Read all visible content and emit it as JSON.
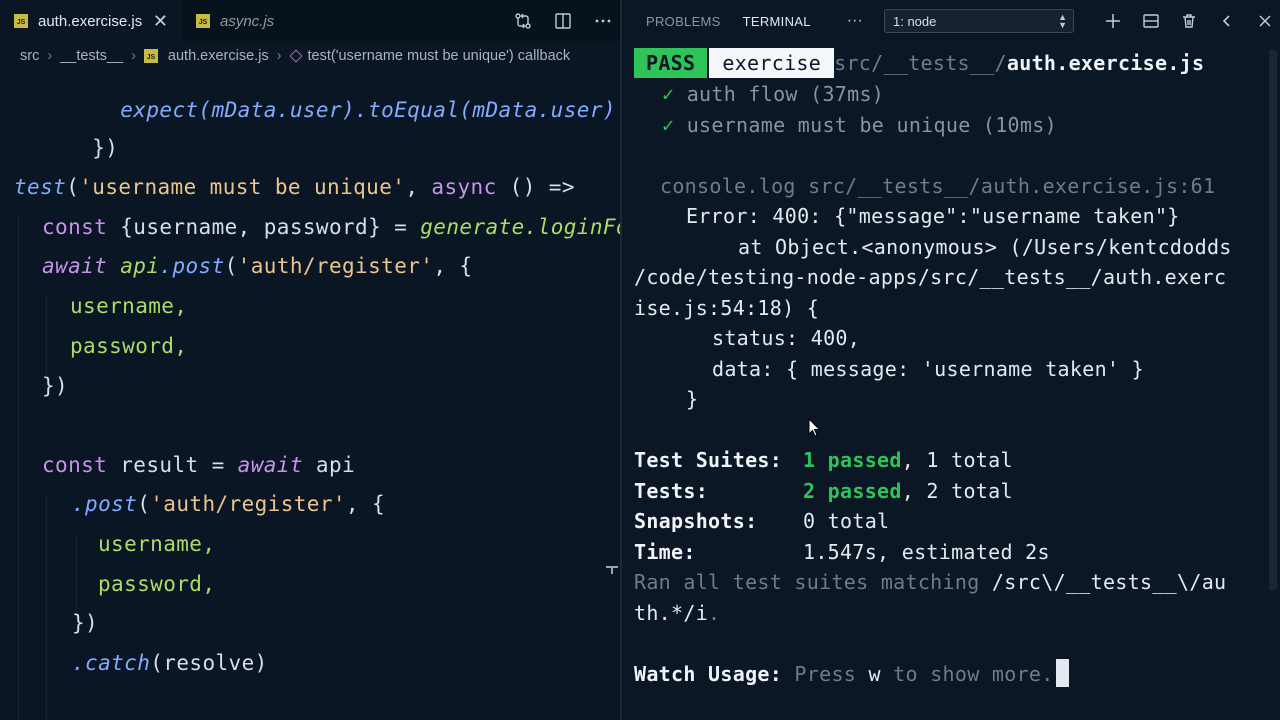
{
  "editor": {
    "tabs": [
      {
        "label": "auth.exercise.js",
        "active": true,
        "icon": "js-file-icon"
      },
      {
        "label": "async.js",
        "active": false,
        "icon": "js-file-icon"
      }
    ],
    "js_badge": "JS",
    "breadcrumb": {
      "parts": [
        "src",
        "__tests__",
        "auth.exercise.js"
      ],
      "symbol": "test('username must be unique') callback"
    },
    "code_lines": {
      "l0": "expect(mData.user).toEqual(mData.user)",
      "l1": "})",
      "l3_fn": "test",
      "l3_p1": "(",
      "l3_str": "'username must be unique'",
      "l3_p2": ", ",
      "l3_kw": "async",
      "l3_p3": " () =>",
      "l4_kw": "const",
      "l4_p1": " {username, password} = ",
      "l4_fn": "generate.loginForm()",
      "l5_kw": "await",
      "l5_obj": " api",
      "l5_fn": ".post",
      "l5_p1": "(",
      "l5_str": "'auth/register'",
      "l5_p2": ", {",
      "l6": "username,",
      "l7": "password,",
      "l8": "})",
      "l10_kw": "const",
      "l10_p1": " result = ",
      "l10_kw2": "await",
      "l10_p2": " api",
      "l11_fn": ".post",
      "l11_p1": "(",
      "l11_str": "'auth/register'",
      "l11_p2": ", {",
      "l12": "username,",
      "l13": "password,",
      "l14": "})",
      "l15_fn": ".catch",
      "l15_p1": "(resolve)"
    }
  },
  "panel": {
    "tabs": [
      "PROBLEMS",
      "TERMINAL"
    ],
    "active_tab": "TERMINAL",
    "more": "···",
    "terminal_select": "1: node",
    "actions": [
      "plus-icon",
      "split-icon",
      "trash-icon",
      "chevron-left-icon",
      "close-icon"
    ]
  },
  "terminal": {
    "pass_badge": "PASS",
    "suite_name": "exercise",
    "path_prefix": "src/__tests__/",
    "path_file": "auth.exercise.js",
    "check": "✓",
    "test1": "auth flow (37ms)",
    "test2": "username must be unique (10ms)",
    "console_log": "console.log src/__tests__/auth.exercise.js:61",
    "error_line": "Error: 400: {\"message\":\"username taken\"}",
    "at_line": "at Object.<anonymous> (/Users/kentcdodds",
    "path_line": "/code/testing-node-apps/src/__tests__/auth.exerc",
    "path_line2": "ise.js:54:18) {",
    "status_line": "status: 400,",
    "data_line": "data: { message: 'username taken' }",
    "close_brace": "}",
    "summary": {
      "suites_label": "Test Suites:",
      "suites_passed": "1 passed",
      "suites_total": ", 1 total",
      "tests_label": "Tests:",
      "tests_passed": "2 passed",
      "tests_total": ", 2 total",
      "snapshots_label": "Snapshots:",
      "snapshots_value": "0 total",
      "time_label": "Time:",
      "time_value": "1.547s, estimated 2s"
    },
    "ran_prefix": "Ran all test suites matching ",
    "ran_pattern1": "/src\\/__tests__\\/au",
    "ran_pattern2": "th.*/i",
    "ran_suffix": ".",
    "watch_label": "Watch Usage:",
    "watch_press": " Press ",
    "watch_key": "w",
    "watch_rest": " to show more."
  },
  "colors": {
    "background": "#0b1725",
    "pass_badge": "#2ec45a",
    "keyword": "#c792ea",
    "function": "#82aaff",
    "string": "#ecc48d",
    "property": "#addb67"
  }
}
